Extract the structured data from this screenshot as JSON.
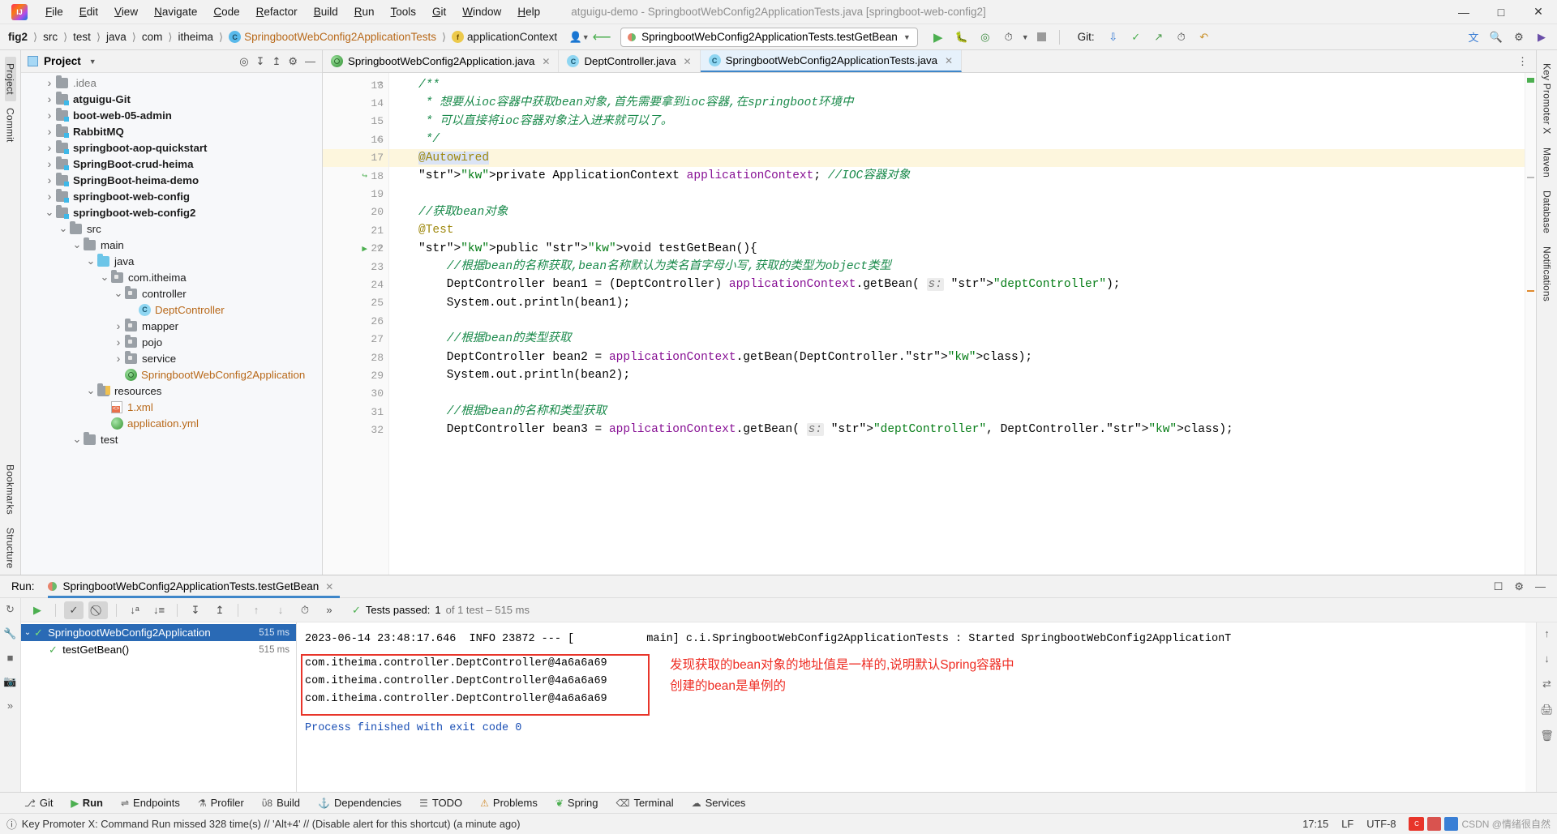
{
  "window": {
    "title": "atguigu-demo - SpringbootWebConfig2ApplicationTests.java [springboot-web-config2]",
    "minimize": "—",
    "maximize": "□",
    "close": "✕"
  },
  "menu": [
    "File",
    "Edit",
    "View",
    "Navigate",
    "Code",
    "Refactor",
    "Build",
    "Run",
    "Tools",
    "Git",
    "Window",
    "Help"
  ],
  "breadcrumbs": [
    {
      "label": "fig2",
      "style": "bold"
    },
    {
      "label": "src",
      "style": "plain"
    },
    {
      "label": "test",
      "style": "plain"
    },
    {
      "label": "java",
      "style": "plain"
    },
    {
      "label": "com",
      "style": "plain"
    },
    {
      "label": "itheima",
      "style": "plain"
    },
    {
      "label": "SpringbootWebConfig2ApplicationTests",
      "style": "class"
    },
    {
      "label": "applicationContext",
      "style": "field"
    }
  ],
  "toolbar": {
    "run_config": "SpringbootWebConfig2ApplicationTests.testGetBean",
    "git_label": "Git:",
    "icons": [
      "run-icon",
      "debug-icon",
      "run-coverage-icon",
      "profiler-icon",
      "stop-icon"
    ]
  },
  "project_panel": {
    "title": "Project",
    "tree": [
      {
        "label": ".idea",
        "depth": 1,
        "arrow": "›",
        "icon": "folder-gray",
        "style": "gray"
      },
      {
        "label": "atguigu-Git",
        "depth": 1,
        "arrow": "›",
        "icon": "folder-module",
        "style": "bold"
      },
      {
        "label": "boot-web-05-admin",
        "depth": 1,
        "arrow": "›",
        "icon": "folder-module",
        "style": "bold"
      },
      {
        "label": "RabbitMQ",
        "depth": 1,
        "arrow": "›",
        "icon": "folder-module",
        "style": "bold"
      },
      {
        "label": "springboot-aop-quickstart",
        "depth": 1,
        "arrow": "›",
        "icon": "folder-module",
        "style": "bold"
      },
      {
        "label": "SpringBoot-crud-heima",
        "depth": 1,
        "arrow": "›",
        "icon": "folder-module",
        "style": "bold"
      },
      {
        "label": "SpringBoot-heima-demo",
        "depth": 1,
        "arrow": "›",
        "icon": "folder-module",
        "style": "bold"
      },
      {
        "label": "springboot-web-config",
        "depth": 1,
        "arrow": "›",
        "icon": "folder-module",
        "style": "bold"
      },
      {
        "label": "springboot-web-config2",
        "depth": 1,
        "arrow": "⌄",
        "icon": "folder-module",
        "style": "bold"
      },
      {
        "label": "src",
        "depth": 2,
        "arrow": "⌄",
        "icon": "folder-gray",
        "style": "plain"
      },
      {
        "label": "main",
        "depth": 3,
        "arrow": "⌄",
        "icon": "folder-gray",
        "style": "plain"
      },
      {
        "label": "java",
        "depth": 4,
        "arrow": "⌄",
        "icon": "folder-source",
        "style": "plain"
      },
      {
        "label": "com.itheima",
        "depth": 5,
        "arrow": "⌄",
        "icon": "folder-package",
        "style": "plain"
      },
      {
        "label": "controller",
        "depth": 6,
        "arrow": "⌄",
        "icon": "folder-package",
        "style": "plain"
      },
      {
        "label": "DeptController",
        "depth": 7,
        "arrow": "",
        "icon": "class-icon",
        "style": "orange"
      },
      {
        "label": "mapper",
        "depth": 6,
        "arrow": "›",
        "icon": "folder-package",
        "style": "plain"
      },
      {
        "label": "pojo",
        "depth": 6,
        "arrow": "›",
        "icon": "folder-package",
        "style": "plain"
      },
      {
        "label": "service",
        "depth": 6,
        "arrow": "›",
        "icon": "folder-package",
        "style": "plain"
      },
      {
        "label": "SpringbootWebConfig2Application",
        "depth": 6,
        "arrow": "",
        "icon": "spring-icon",
        "style": "orange"
      },
      {
        "label": "resources",
        "depth": 4,
        "arrow": "⌄",
        "icon": "folder-resources",
        "style": "plain"
      },
      {
        "label": "1.xml",
        "depth": 5,
        "arrow": "",
        "icon": "xml-icon",
        "style": "orange"
      },
      {
        "label": "application.yml",
        "depth": 5,
        "arrow": "",
        "icon": "yml-icon",
        "style": "orange"
      },
      {
        "label": "test",
        "depth": 3,
        "arrow": "⌄",
        "icon": "folder-gray",
        "style": "plain"
      }
    ]
  },
  "editor": {
    "tabs": [
      {
        "label": "SpringbootWebConfig2Application.java",
        "icon": "spring-icon",
        "active": false
      },
      {
        "label": "DeptController.java",
        "icon": "class-icon",
        "active": false
      },
      {
        "label": "SpringbootWebConfig2ApplicationTests.java",
        "icon": "class-icon",
        "active": true
      }
    ],
    "lines": [
      {
        "n": 13,
        "fold": "▽",
        "text": "/**",
        "hl": false
      },
      {
        "n": 14,
        "fold": "",
        "text": " * 想要从ioc容器中获取bean对象,首先需要拿到ioc容器,在springboot环境中",
        "hl": false
      },
      {
        "n": 15,
        "fold": "",
        "text": " * 可以直接将ioc容器对象注入进来就可以了。",
        "hl": false
      },
      {
        "n": 16,
        "fold": "⌂",
        "text": " */",
        "hl": false
      },
      {
        "n": 17,
        "fold": "",
        "text": "@Autowired",
        "hl": true
      },
      {
        "n": 18,
        "fold": "",
        "mark": "bean-icon",
        "text": "private ApplicationContext applicationContext; //IOC容器对象",
        "hl": false
      },
      {
        "n": 19,
        "fold": "",
        "text": "",
        "hl": false
      },
      {
        "n": 20,
        "fold": "",
        "text": "//获取bean对象",
        "hl": false
      },
      {
        "n": 21,
        "fold": "",
        "text": "@Test",
        "hl": false
      },
      {
        "n": 22,
        "fold": "▽",
        "mark": "run-test-icon",
        "text": "public void testGetBean(){",
        "hl": false
      },
      {
        "n": 23,
        "fold": "",
        "text": "    //根据bean的名称获取,bean名称默认为类名首字母小写,获取的类型为object类型",
        "hl": false
      },
      {
        "n": 24,
        "fold": "",
        "text": "    DeptController bean1 = (DeptController) applicationContext.getBean( s: \"deptController\");",
        "hl": false
      },
      {
        "n": 25,
        "fold": "",
        "text": "    System.out.println(bean1);",
        "hl": false
      },
      {
        "n": 26,
        "fold": "",
        "text": "",
        "hl": false
      },
      {
        "n": 27,
        "fold": "",
        "text": "    //根据bean的类型获取",
        "hl": false
      },
      {
        "n": 28,
        "fold": "",
        "text": "    DeptController bean2 = applicationContext.getBean(DeptController.class);",
        "hl": false
      },
      {
        "n": 29,
        "fold": "",
        "text": "    System.out.println(bean2);",
        "hl": false
      },
      {
        "n": 30,
        "fold": "",
        "text": "",
        "hl": false
      },
      {
        "n": 31,
        "fold": "",
        "text": "    //根据bean的名称和类型获取",
        "hl": false
      },
      {
        "n": 32,
        "fold": "",
        "text": "    DeptController bean3 = applicationContext.getBean( s: \"deptController\", DeptController.class);",
        "hl": false
      }
    ]
  },
  "run_panel": {
    "label": "Run:",
    "tab_title": "SpringbootWebConfig2ApplicationTests.testGetBean",
    "tests_passed_prefix": "Tests passed:",
    "tests_passed_count": "1",
    "tests_passed_suffix": "of 1 test – 515 ms",
    "tree": [
      {
        "label": "SpringbootWebConfig2Application",
        "ms": "515 ms",
        "selected": true,
        "arrow": "⌄"
      },
      {
        "label": "testGetBean()",
        "ms": "515 ms",
        "selected": false,
        "arrow": ""
      }
    ],
    "console": {
      "log_line": "2023-06-14 23:48:17.646  INFO 23872 --- [           main] c.i.SpringbootWebConfig2ApplicationTests : Started SpringbootWebConfig2ApplicationT",
      "outputs": [
        "com.itheima.controller.DeptController@4a6a6a69",
        "com.itheima.controller.DeptController@4a6a6a69",
        "com.itheima.controller.DeptController@4a6a6a69"
      ],
      "finish_line": "Process finished with exit code 0",
      "annotation_line1": "发现获取的bean对象的地址值是一样的,说明默认Spring容器中",
      "annotation_line2": "创建的bean是单例的",
      "annotation_color": "#ee2b22",
      "box_color": "#e8352a"
    }
  },
  "bottom_toolbar": [
    {
      "label": "Git",
      "icon": "git-icon"
    },
    {
      "label": "Run",
      "icon": "run-icon",
      "selected": true
    },
    {
      "label": "Endpoints",
      "icon": "endpoints-icon"
    },
    {
      "label": "Profiler",
      "icon": "profiler-icon"
    },
    {
      "label": "Build",
      "icon": "build-icon"
    },
    {
      "label": "Dependencies",
      "icon": "dependencies-icon"
    },
    {
      "label": "TODO",
      "icon": "todo-icon"
    },
    {
      "label": "Problems",
      "icon": "problems-icon"
    },
    {
      "label": "Spring",
      "icon": "spring-icon"
    },
    {
      "label": "Terminal",
      "icon": "terminal-icon"
    },
    {
      "label": "Services",
      "icon": "services-icon"
    }
  ],
  "statusbar": {
    "message": "Key Promoter X: Command Run missed 328 time(s) // 'Alt+4' // (Disable alert for this shortcut) (a minute ago)",
    "time": "17:15",
    "line_sep": "LF",
    "encoding": "UTF-8",
    "watermark": "CSDN @情绪很自然"
  },
  "left_rail": [
    "Project",
    "Commit"
  ],
  "left_rail_bottom": [
    "Bookmarks",
    "Structure"
  ],
  "right_rail": [
    "Key Promoter X",
    "Maven",
    "Database",
    "Notifications"
  ]
}
